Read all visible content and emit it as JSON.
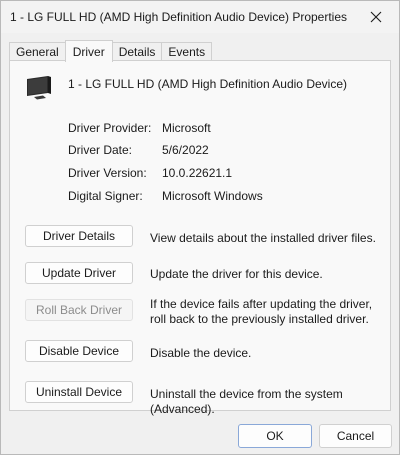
{
  "window": {
    "title": "1 - LG FULL HD (AMD High Definition Audio Device) Properties"
  },
  "tabs": [
    {
      "label": "General"
    },
    {
      "label": "Driver"
    },
    {
      "label": "Details"
    },
    {
      "label": "Events"
    }
  ],
  "device": {
    "name": "1 - LG FULL HD (AMD High Definition Audio Device)",
    "icon": "monitor-icon"
  },
  "info": {
    "provider_label": "Driver Provider:",
    "provider_value": "Microsoft",
    "date_label": "Driver Date:",
    "date_value": "5/6/2022",
    "version_label": "Driver Version:",
    "version_value": "10.0.22621.1",
    "signer_label": "Digital Signer:",
    "signer_value": "Microsoft Windows"
  },
  "actions": {
    "details_label": "Driver Details",
    "details_desc": "View details about the installed driver files.",
    "update_label": "Update Driver",
    "update_desc": "Update the driver for this device.",
    "rollback_label": "Roll Back Driver",
    "rollback_desc": "If the device fails after updating the driver, roll back to the previously installed driver.",
    "disable_label": "Disable Device",
    "disable_desc": "Disable the device.",
    "uninstall_label": "Uninstall Device",
    "uninstall_desc": "Uninstall the device from the system (Advanced)."
  },
  "footer": {
    "ok_label": "OK",
    "cancel_label": "Cancel"
  }
}
